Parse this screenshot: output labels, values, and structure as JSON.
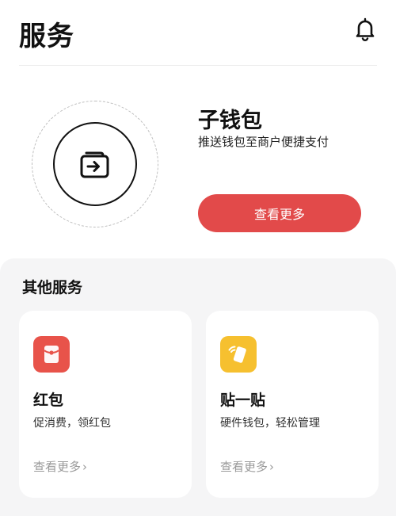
{
  "header": {
    "title": "服务",
    "bell_icon": "bell-icon"
  },
  "hero": {
    "icon": "wallet-transfer-icon",
    "title": "子钱包",
    "subtitle": "推送钱包至商户便捷支付",
    "button_label": "查看更多",
    "button_color": "#e24a4a"
  },
  "other_services": {
    "title": "其他服务",
    "cards": [
      {
        "icon": "red-packet-icon",
        "icon_color": "#e8534a",
        "title": "红包",
        "subtitle": "促消费，领红包",
        "link": "查看更多",
        "link_chevron": "›"
      },
      {
        "icon": "nfc-card-tap-icon",
        "icon_color": "#f6c02f",
        "title": "贴一贴",
        "subtitle": "硬件钱包，轻松管理",
        "link": "查看更多",
        "link_chevron": "›"
      }
    ]
  }
}
